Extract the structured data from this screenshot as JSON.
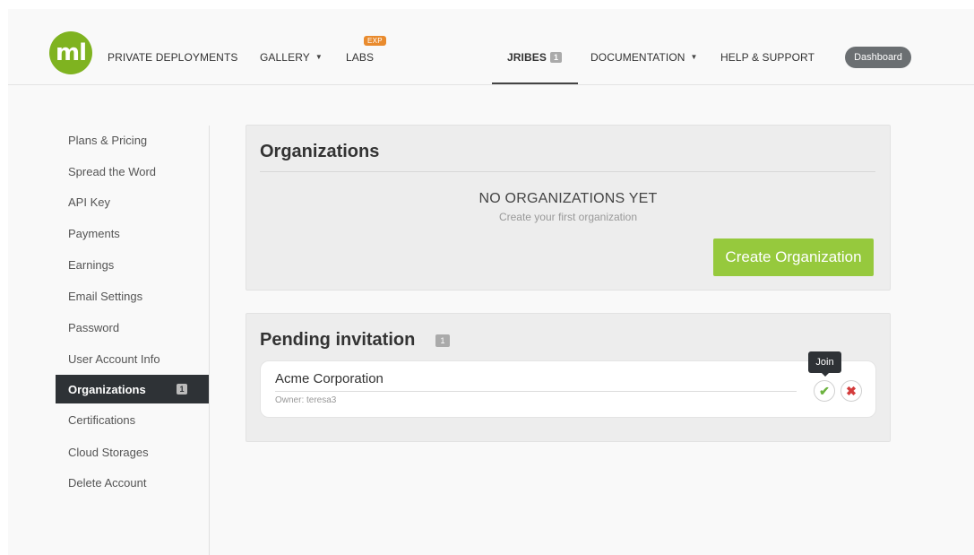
{
  "nav": {
    "logo_text": "ml",
    "items": [
      {
        "label": "PRIVATE DEPLOYMENTS"
      },
      {
        "label": "GALLERY",
        "caret": "▼"
      },
      {
        "label": "LABS",
        "badge": "EXP"
      },
      {
        "label": "JRIBES",
        "count": "1",
        "active": true
      },
      {
        "label": "DOCUMENTATION",
        "caret": "▼"
      },
      {
        "label": "HELP & SUPPORT"
      }
    ],
    "dashboard_label": "Dashboard"
  },
  "sidebar": {
    "items": [
      {
        "label": "Plans & Pricing"
      },
      {
        "label": "Spread the Word"
      },
      {
        "label": "API Key"
      },
      {
        "label": "Payments"
      },
      {
        "label": "Earnings"
      },
      {
        "label": "Email Settings"
      },
      {
        "label": "Password"
      },
      {
        "label": "User Account Info"
      },
      {
        "label": "Organizations",
        "active": true,
        "count": "1"
      },
      {
        "label": "Certifications"
      },
      {
        "label": "Cloud Storages"
      },
      {
        "label": "Delete Account"
      }
    ]
  },
  "organizations": {
    "title": "Organizations",
    "empty_title": "NO ORGANIZATIONS YET",
    "empty_subtitle": "Create your first organization",
    "create_button": "Create Organization"
  },
  "pending": {
    "title": "Pending invitation",
    "count": "1",
    "invitation": {
      "name": "Acme Corporation",
      "owner": "Owner: teresa3"
    },
    "join_tooltip": "Join",
    "join_icon": "check-icon",
    "decline_icon": "x-icon"
  },
  "colors": {
    "brand_green": "#7fb320",
    "create_button": "#96c93d",
    "sidebar_active": "#2e3236",
    "exp_badge": "#e98b2e",
    "decline_red": "#d43c3c"
  }
}
